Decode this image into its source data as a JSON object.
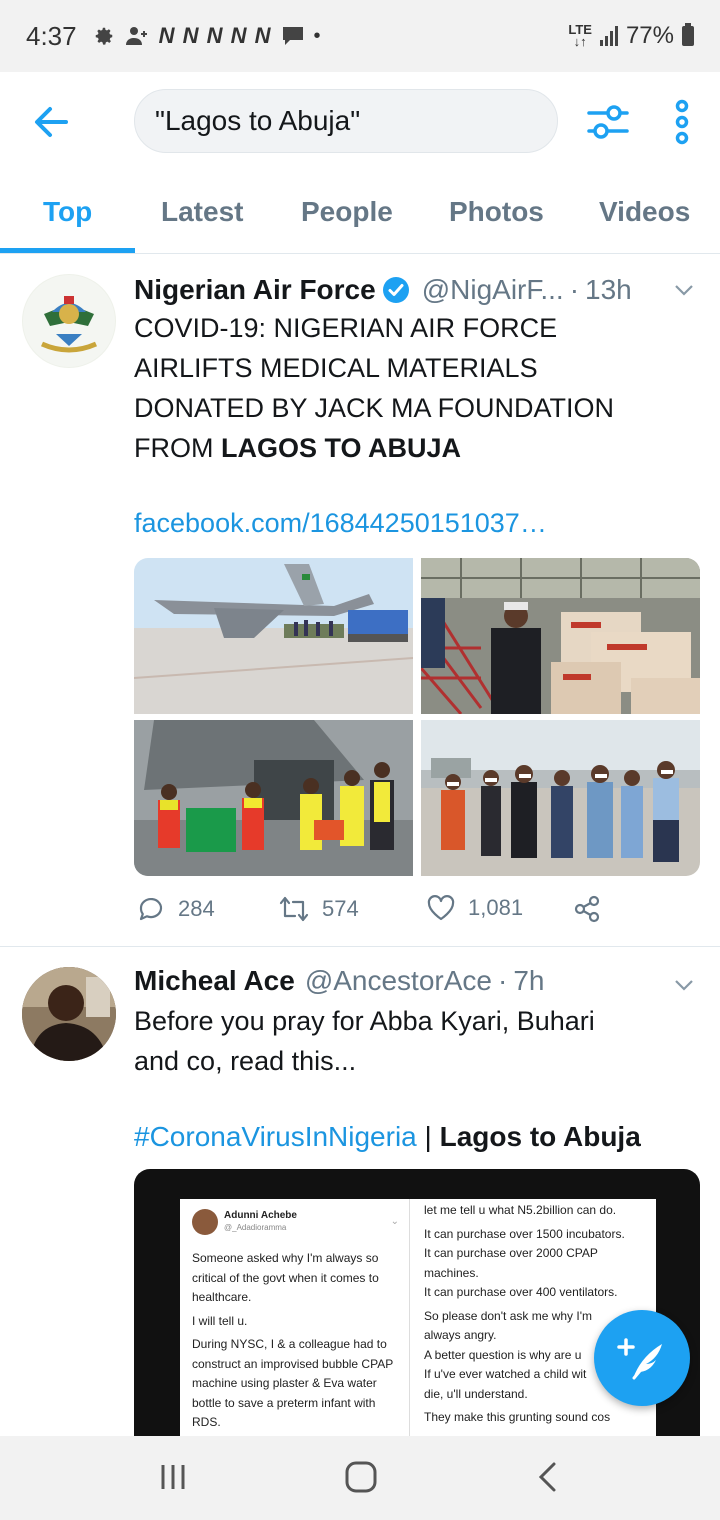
{
  "status_bar": {
    "time": "4:37",
    "notif_glyphs": "N N N N N",
    "network": "LTE",
    "battery": "77%"
  },
  "search": {
    "query": "\"Lagos to Abuja\""
  },
  "tabs": [
    {
      "label": "Top",
      "active": true
    },
    {
      "label": "Latest",
      "active": false
    },
    {
      "label": "People",
      "active": false
    },
    {
      "label": "Photos",
      "active": false
    },
    {
      "label": "Videos",
      "active": false
    }
  ],
  "tweets": [
    {
      "name": "Nigerian Air Force",
      "handle": "@NigAirF...",
      "time": "13h",
      "text_lines": [
        "COVID-19: NIGERIAN AIR FORCE",
        "AIRLIFTS MEDICAL MATERIALS",
        "DONATED BY JACK MA FOUNDATION",
        "FROM "
      ],
      "text_highlight": "LAGOS TO ABUJA",
      "link": "facebook.com/16844250151037…",
      "replies": "284",
      "retweets": "574",
      "likes": "1,081"
    },
    {
      "name": "Micheal Ace",
      "handle": "@AncestorAce",
      "time": "7h",
      "text_lines": [
        "Before you pray for Abba Kyari, Buhari",
        "and co, read this..."
      ],
      "hashtag": "#CoronaVirusInNigeria",
      "divider": " | ",
      "hashtag_highlight": "Lagos to Abuja",
      "embed": {
        "author": "Adunni Achebe",
        "author_handle": "@_Adadioramma",
        "left_lines": [
          "Someone asked why I'm always so",
          "critical of the govt when it comes to",
          "healthcare.",
          "",
          "I will tell u.",
          "",
          "During NYSC, I & a colleague had to",
          "construct an improvised bubble CPAP",
          "machine using plaster & Eva water",
          "bottle to save a preterm infant with",
          "RDS."
        ],
        "right_lines": [
          "let me tell u what N5.2billion can do.",
          "",
          "It can purchase over 1500 incubators.",
          "It can purchase over 2000 CPAP",
          "machines.",
          "It can purchase over 400 ventilators.",
          "",
          "So please don't ask me why I'm",
          "always angry.",
          "A better question is why are u",
          "If u've ever watched a child wit",
          "die, u'll understand.",
          "",
          "They make this grunting sound cos"
        ]
      }
    }
  ],
  "colors": {
    "accent": "#1da1f2",
    "link": "#1b95e0",
    "secondary_text": "#657786"
  }
}
